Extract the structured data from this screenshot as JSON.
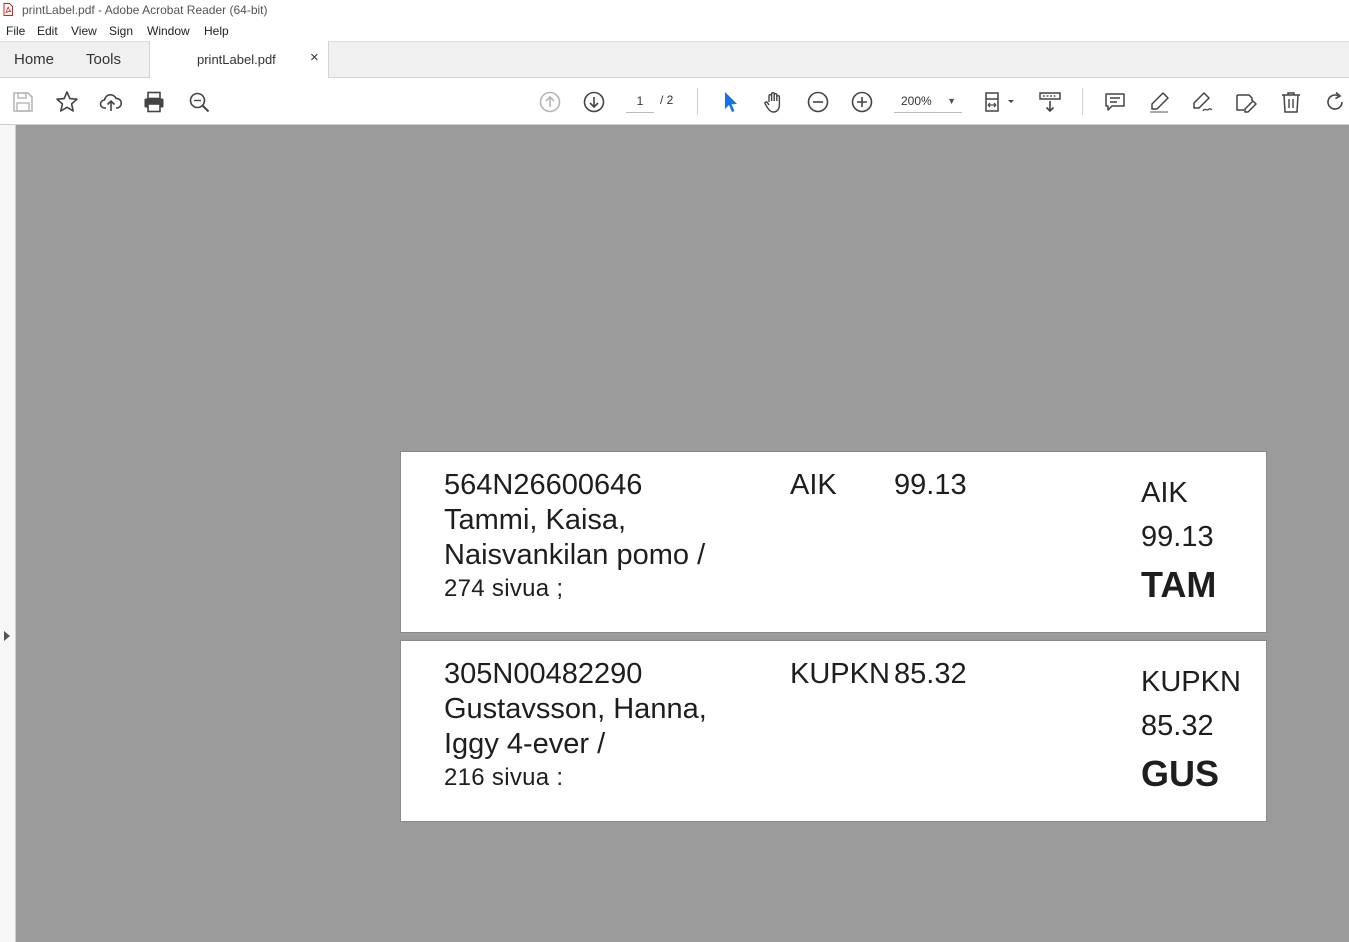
{
  "window": {
    "title": "printLabel.pdf - Adobe Acrobat Reader (64-bit)"
  },
  "menu": [
    "File",
    "Edit",
    "View",
    "Sign",
    "Window",
    "Help"
  ],
  "tabs": {
    "home": "Home",
    "tools": "Tools",
    "document": "printLabel.pdf",
    "close": "×"
  },
  "toolbar": {
    "page_current": "1",
    "page_total": "/ 2",
    "zoom": "200%"
  },
  "labels": [
    {
      "id": "564N26600646",
      "author": "Tammi, Kaisa,",
      "title": "Naisvankilan pomo /",
      "pages": "274 sivua ;",
      "shelf": "AIK",
      "class": "99.13",
      "spine_shelf": "AIK",
      "spine_class": "99.13",
      "spine_code": "TAM"
    },
    {
      "id": "305N00482290",
      "author": "Gustavsson, Hanna,",
      "title": "Iggy 4-ever /",
      "pages": "216 sivua :",
      "shelf": "KUPKN",
      "class": "85.32",
      "spine_shelf": "KUPKN",
      "spine_class": "85.32",
      "spine_code": "GUS"
    }
  ],
  "colors": {
    "viewer_bg": "#9b9b9b",
    "select_tool": "#1473e6"
  }
}
